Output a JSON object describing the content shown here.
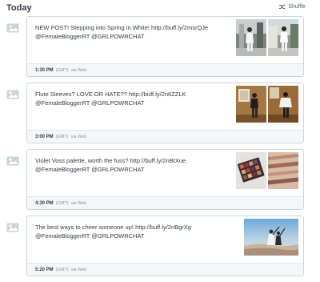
{
  "header": {
    "day": "Today",
    "shuffle_label": "Shuffle"
  },
  "posts": [
    {
      "text": "NEW POST! Stepping into Spring in White! http://buff.ly/2msrQJe @FemaleBloggerRT @GRLPOWRCHAT",
      "time": "1:30 PM",
      "tz": "(GMT)",
      "via": "via Web"
    },
    {
      "text": "Flute Sleeves? LOVE OR HATE?? http://buff.ly/2n6ZZLK @FemaleBloggerRT @GRLPOWRCHAT",
      "time": "3:00 PM",
      "tz": "(GMT)",
      "via": "via Web"
    },
    {
      "text": "Violet Voss palette, worth the fuss? http://buff.ly/2nBtXue @FemaleBloggerRT @GRLPOWRCHAT",
      "time": "4:30 PM",
      "tz": "(GMT)",
      "via": "via Web"
    },
    {
      "text": "The best ways to cheer someone up! http://buff.ly/2nBgrXg @FemaleBloggerRT @GRLPOWRCHAT",
      "time": "5:20 PM",
      "tz": "(GMT)",
      "via": "via Web"
    }
  ],
  "colors": {
    "card_border": "#ccd6dd",
    "footer_bg": "#f4f7f9",
    "text": "#323b43",
    "muted": "#8b9399"
  },
  "icons": {
    "shuffle": "shuffle-icon",
    "post_thumbnail": "image-placeholder-icon"
  }
}
